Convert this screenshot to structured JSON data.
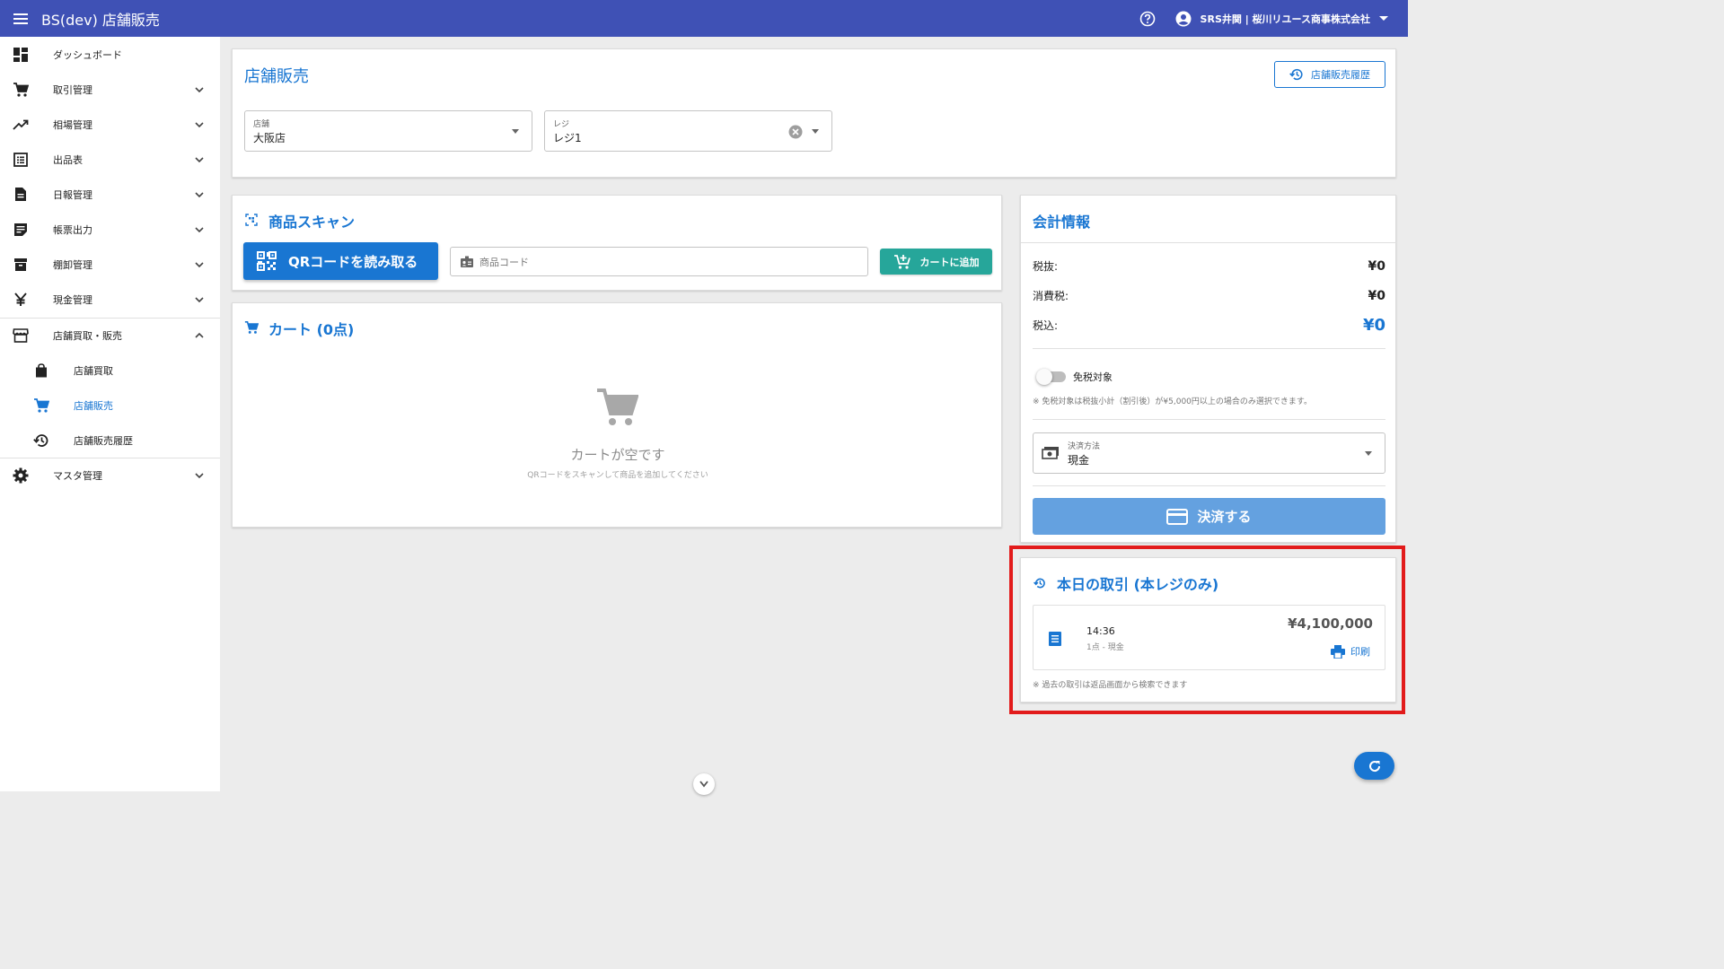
{
  "appbar": {
    "title": "BS(dev) 店舗販売",
    "user": "SRS井関 | 桜川リユース商事株式会社",
    "icons": [
      "menu-icon",
      "help-icon",
      "account-circle-icon",
      "arrow-drop-down-icon"
    ]
  },
  "sidebar": {
    "items": [
      {
        "label": "ダッシュボード",
        "icon": "dashboard-icon"
      },
      {
        "label": "取引管理",
        "icon": "cart-icon"
      },
      {
        "label": "相場管理",
        "icon": "trending-up-icon"
      },
      {
        "label": "出品表",
        "icon": "list-icon"
      },
      {
        "label": "日報管理",
        "icon": "document-icon"
      },
      {
        "label": "帳票出力",
        "icon": "note-icon"
      },
      {
        "label": "棚卸管理",
        "icon": "archive-icon"
      },
      {
        "label": "現金管理",
        "icon": "yen-icon"
      },
      {
        "label": "店舗買取・販売",
        "icon": "store-icon"
      },
      {
        "label": "店舗買取",
        "icon": "shopping-bag-icon"
      },
      {
        "label": "店舗販売",
        "icon": "cart-icon",
        "active": true
      },
      {
        "label": "店舗販売履歴",
        "icon": "history-icon"
      },
      {
        "label": "マスタ管理",
        "icon": "gear-icon"
      }
    ]
  },
  "header_card": {
    "title": "店舗販売",
    "history_button": "店舗販売履歴",
    "store_field": {
      "label": "店舗",
      "value": "大阪店"
    },
    "register_field": {
      "label": "レジ",
      "value": "レジ1"
    }
  },
  "scan_card": {
    "title": "商品スキャン",
    "qr_button": "QRコードを読み取る",
    "code_placeholder": "商品コード",
    "add_button": "カートに追加"
  },
  "cart_card": {
    "title": "カート (0点)",
    "empty_title": "カートが空です",
    "empty_sub": "QRコードをスキャンして商品を追加してください"
  },
  "accounting": {
    "title": "会計情報",
    "rows": [
      {
        "label": "税抜:",
        "value": "¥0"
      },
      {
        "label": "消費税:",
        "value": "¥0"
      },
      {
        "label": "税込:",
        "value": "¥0"
      }
    ],
    "tax_free_label": "免税対象",
    "tax_free_enabled": false,
    "tax_free_note": "※ 免税対象は税抜小計（割引後）が¥5,000円以上の場合のみ選択できます。",
    "payment_field": {
      "label": "決済方法",
      "value": "現金"
    },
    "pay_button": "決済する"
  },
  "today_txn": {
    "title": "本日の取引 (本レジのみ)",
    "items": [
      {
        "time": "14:36",
        "detail": "1点 - 現金",
        "amount": "¥4,100,000",
        "print_label": "印刷"
      }
    ],
    "note": "※ 過去の取引は返品画面から検索できます"
  },
  "colors": {
    "appbar": "#3f51b5",
    "primary": "#1976d2",
    "teal": "#26a69a",
    "pay_button": "#64a1e0",
    "highlight": "#e21b1b"
  }
}
